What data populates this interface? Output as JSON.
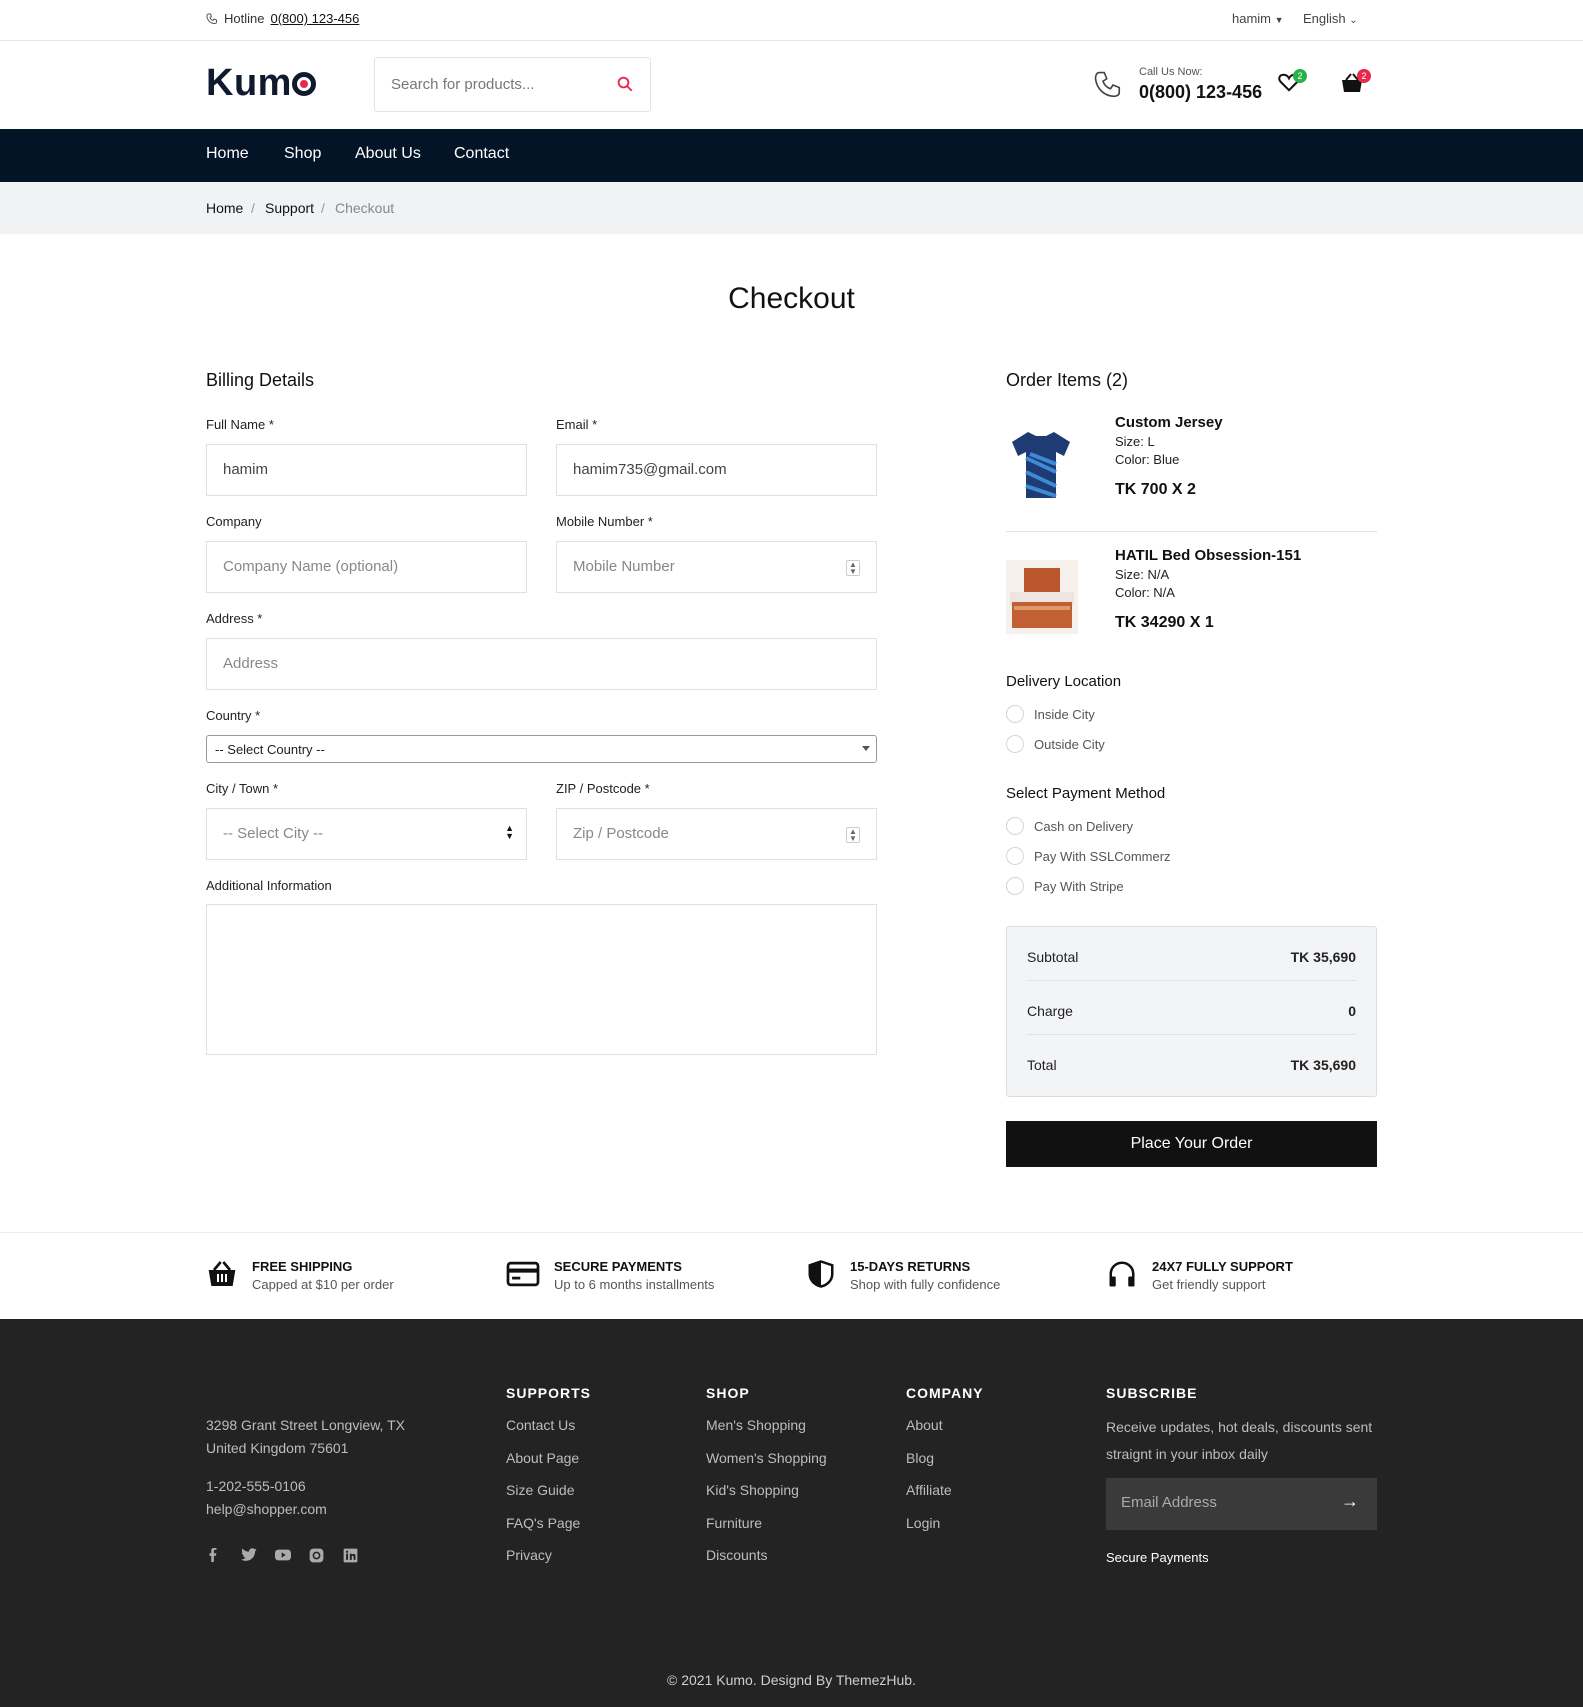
{
  "topbar": {
    "hotline_label": "Hotline",
    "hotline_number": "0(800) 123-456",
    "user": "hamim",
    "language": "English"
  },
  "header": {
    "logo": "Kum",
    "search_placeholder": "Search for products...",
    "call_label": "Call Us Now:",
    "call_number": "0(800) 123-456",
    "wishlist_count": "2",
    "cart_count": "2"
  },
  "nav": {
    "items": [
      "Home",
      "Shop",
      "About Us",
      "Contact"
    ]
  },
  "breadcrumb": {
    "items": [
      "Home",
      "Support",
      "Checkout"
    ],
    "sep": "/"
  },
  "page_title": "Checkout",
  "billing": {
    "title": "Billing Details",
    "full_name_label": "Full Name *",
    "full_name_value": "hamim",
    "email_label": "Email *",
    "email_value": "hamim735@gmail.com",
    "company_label": "Company",
    "company_placeholder": "Company Name (optional)",
    "mobile_label": "Mobile Number *",
    "mobile_placeholder": "Mobile Number",
    "address_label": "Address *",
    "address_placeholder": "Address",
    "country_label": "Country *",
    "country_value": "-- Select Country --",
    "city_label": "City / Town *",
    "city_value": "-- Select City --",
    "zip_label": "ZIP / Postcode *",
    "zip_placeholder": "Zip / Postcode",
    "additional_label": "Additional Information"
  },
  "order": {
    "title": "Order Items (2)",
    "items": [
      {
        "name": "Custom Jersey",
        "size": "Size: L",
        "color": "Color: Blue",
        "price": "TK 700 X 2"
      },
      {
        "name": "HATIL Bed Obsession-151",
        "size": "Size: N/A",
        "color": "Color: N/A",
        "price": "TK 34290 X 1"
      }
    ],
    "delivery_title": "Delivery Location",
    "delivery_options": [
      "Inside City",
      "Outside City"
    ],
    "payment_title": "Select Payment Method",
    "payment_options": [
      "Cash on Delivery",
      "Pay With SSLCommerz",
      "Pay With Stripe"
    ],
    "summary": {
      "subtotal_label": "Subtotal",
      "subtotal": "TK 35,690",
      "charge_label": "Charge",
      "charge": "0",
      "total_label": "Total",
      "total": "TK 35,690"
    },
    "place_order": "Place Your Order"
  },
  "features": [
    {
      "title": "FREE SHIPPING",
      "sub": "Capped at $10 per order",
      "icon": "basket-icon"
    },
    {
      "title": "SECURE PAYMENTS",
      "sub": "Up to 6 months installments",
      "icon": "credit-card-icon"
    },
    {
      "title": "15-DAYS RETURNS",
      "sub": "Shop with fully confidence",
      "icon": "shield-icon"
    },
    {
      "title": "24X7 FULLY SUPPORT",
      "sub": "Get friendly support",
      "icon": "headphones-icon"
    }
  ],
  "footer": {
    "address1": "3298 Grant Street Longview, TX",
    "address2": "United Kingdom 75601",
    "phone": "1-202-555-0106",
    "email": "help@shopper.com",
    "supports_title": "SUPPORTS",
    "supports": [
      "Contact Us",
      "About Page",
      "Size Guide",
      "FAQ's Page",
      "Privacy"
    ],
    "shop_title": "SHOP",
    "shop": [
      "Men's Shopping",
      "Women's Shopping",
      "Kid's Shopping",
      "Furniture",
      "Discounts"
    ],
    "company_title": "COMPANY",
    "company": [
      "About",
      "Blog",
      "Affiliate",
      "Login"
    ],
    "subscribe_title": "SUBSCRIBE",
    "subscribe_text1": "Receive updates, hot deals, discounts sent",
    "subscribe_text2": "straignt in your inbox daily",
    "email_placeholder": "Email Address",
    "secure": "Secure Payments",
    "copyright": "© 2021 Kumo. Designd By ThemezHub."
  },
  "colors": {
    "accent": "#e8294b",
    "nav_bg": "#041427",
    "footer_bg": "#232323",
    "badge_green": "#2ab04a"
  }
}
